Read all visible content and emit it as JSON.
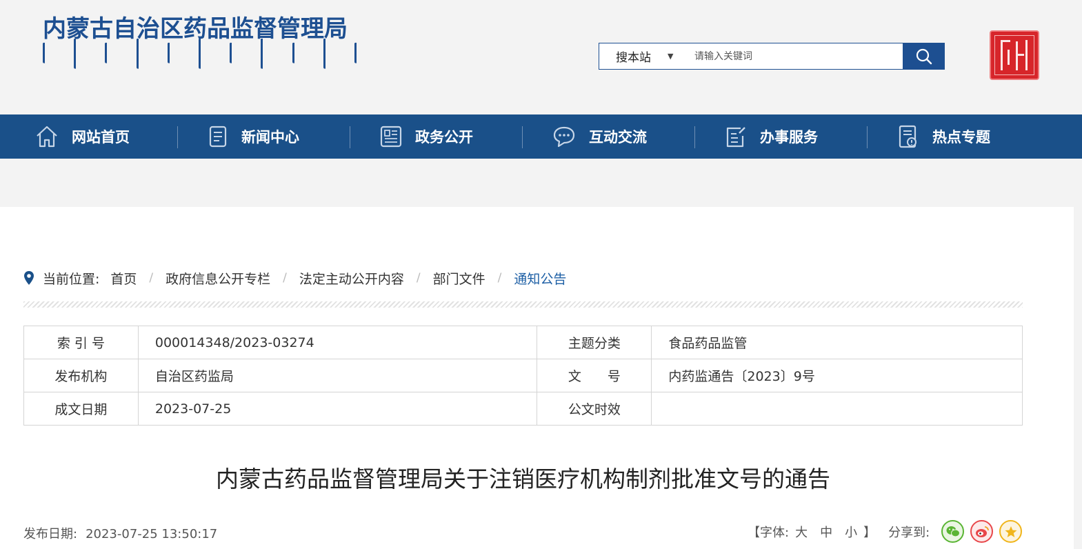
{
  "header": {
    "site_title": "内蒙古自治区药品监督管理局",
    "search": {
      "scope_label": "搜本站",
      "placeholder": "请输入关键词"
    }
  },
  "nav": {
    "items": [
      {
        "label": "网站首页",
        "icon": "home-icon"
      },
      {
        "label": "新闻中心",
        "icon": "news-icon"
      },
      {
        "label": "政务公开",
        "icon": "newspaper-icon"
      },
      {
        "label": "互动交流",
        "icon": "chat-icon"
      },
      {
        "label": "办事服务",
        "icon": "edit-document-icon"
      },
      {
        "label": "热点专题",
        "icon": "hot-topic-icon"
      }
    ]
  },
  "breadcrumb": {
    "label": "当前位置:",
    "items": [
      "首页",
      "政府信息公开专栏",
      "法定主动公开内容",
      "部门文件",
      "通知公告"
    ]
  },
  "meta": {
    "index_no_label": "索 引 号",
    "index_no": "000014348/2023-03274",
    "topic_label": "主题分类",
    "topic": "食品药品监管",
    "publisher_label": "发布机构",
    "publisher": "自治区药监局",
    "doc_no_label": "文　　号",
    "doc_no": "内药监通告〔2023〕9号",
    "date_label": "成文日期",
    "date": "2023-07-25",
    "validity_label": "公文时效",
    "validity": ""
  },
  "article": {
    "title": "内蒙古药品监督管理局关于注销医疗机构制剂批准文号的通告",
    "publish_label": "发布日期:",
    "publish_time": "2023-07-25 13:50:17"
  },
  "tools": {
    "font_open": "【字体:",
    "font_large": "大",
    "font_medium": "中",
    "font_small": "小",
    "font_close": "】",
    "share_label": "分享到:",
    "share": [
      {
        "icon": "wechat-icon",
        "color": "#5ab534"
      },
      {
        "icon": "weibo-icon",
        "color": "#e8474a"
      },
      {
        "icon": "qzone-icon",
        "color": "#f0b51b"
      }
    ]
  },
  "colors": {
    "brand_blue": "#1a5089",
    "link_blue": "#1d5fa5",
    "seal_red": "#d7252a"
  }
}
